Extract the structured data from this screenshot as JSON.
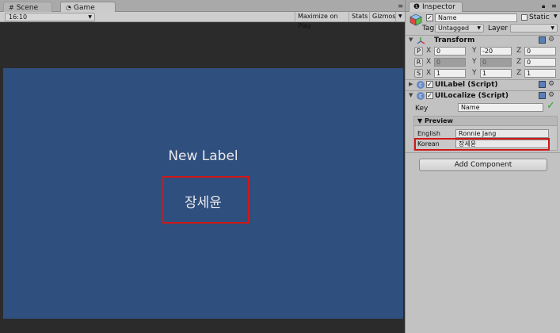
{
  "scene_tab": {
    "icon": "grid-icon",
    "label": "Scene"
  },
  "game_tab": {
    "icon": "pacman-icon",
    "label": "Game"
  },
  "game_toolbar": {
    "aspect": "16:10",
    "maximize": "Maximize on Play",
    "stats": "Stats",
    "gizmos": "Gizmos"
  },
  "game_view": {
    "label_text": "New Label",
    "localized_text": "장세윤",
    "background_color": "#2f4f7e"
  },
  "inspector": {
    "tab_label": "Inspector",
    "object_name": "Name",
    "static_label": "Static",
    "tag_label": "Tag",
    "tag_value": "Untagged",
    "layer_label": "Layer",
    "layer_value": "",
    "transform": {
      "title": "Transform",
      "position": {
        "button": "P",
        "x": "0",
        "y": "-20",
        "z": "0"
      },
      "rotation": {
        "button": "R",
        "x": "0",
        "y": "0",
        "z": "0"
      },
      "scale": {
        "button": "S",
        "x": "1",
        "y": "1",
        "z": "1"
      }
    },
    "uilabel": {
      "title": "UILabel (Script)"
    },
    "uilocalize": {
      "title": "UILocalize (Script)",
      "key_label": "Key",
      "key_value": "Name",
      "preview_title": "▼ Preview",
      "rows": [
        {
          "language": "English",
          "value": "Ronnie Jang"
        },
        {
          "language": "Korean",
          "value": "장세윤"
        }
      ]
    },
    "add_component": "Add Component"
  }
}
